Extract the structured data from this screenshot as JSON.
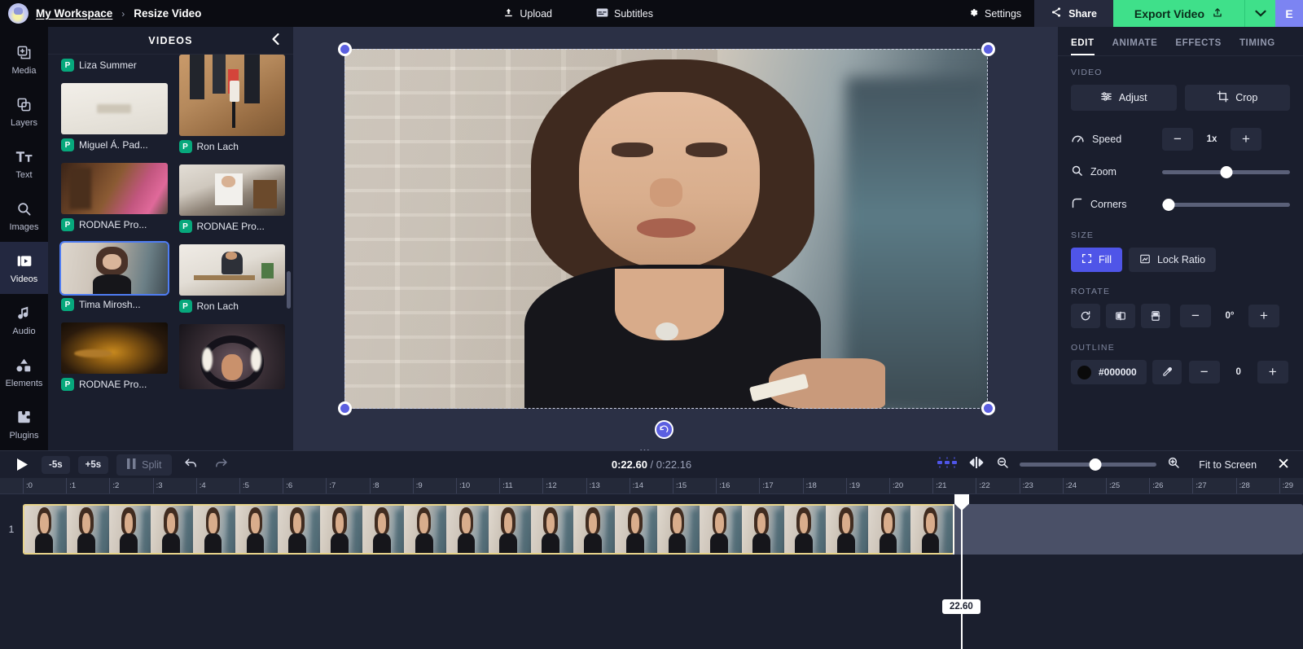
{
  "header": {
    "workspace": "My Workspace",
    "separator": "›",
    "project": "Resize Video",
    "upload": "Upload",
    "subtitles": "Subtitles",
    "settings": "Settings",
    "share": "Share",
    "export": "Export Video",
    "user_initial": "E",
    "export_color": "#3fe08a",
    "accent_color": "#4f55e8"
  },
  "rail": {
    "items": [
      {
        "label": "Media",
        "icon": "media-icon",
        "active": false
      },
      {
        "label": "Layers",
        "icon": "layers-icon",
        "active": false
      },
      {
        "label": "Text",
        "icon": "text-icon",
        "active": false
      },
      {
        "label": "Images",
        "icon": "images-search-icon",
        "active": false
      },
      {
        "label": "Videos",
        "icon": "videos-icon",
        "active": true
      },
      {
        "label": "Audio",
        "icon": "audio-note-icon",
        "active": false
      },
      {
        "label": "Elements",
        "icon": "elements-icon",
        "active": false
      },
      {
        "label": "Plugins",
        "icon": "plugins-icon",
        "active": false
      }
    ]
  },
  "videos_panel": {
    "title": "VIDEOS",
    "collapse_icon": "chevron-left-icon",
    "badge_letter": "P",
    "left_column": [
      {
        "label": "Liza Summer",
        "selected": false,
        "partial_top": true
      },
      {
        "label": "Miguel Á. Pad...",
        "selected": false
      },
      {
        "label": "RODNAE Pro...",
        "selected": false
      },
      {
        "label": "Tima Mirosh...",
        "selected": true
      },
      {
        "label": "RODNAE Pro...",
        "selected": false
      }
    ],
    "right_column": [
      {
        "label": "Ron Lach",
        "selected": false
      },
      {
        "label": "RODNAE Pro...",
        "selected": false
      },
      {
        "label": "Ron Lach",
        "selected": false
      },
      {
        "label": "",
        "selected": false
      }
    ]
  },
  "properties": {
    "tabs": [
      {
        "label": "EDIT",
        "active": true
      },
      {
        "label": "ANIMATE",
        "active": false
      },
      {
        "label": "EFFECTS",
        "active": false
      },
      {
        "label": "TIMING",
        "active": false
      }
    ],
    "video_section": "VIDEO",
    "adjust": "Adjust",
    "crop": "Crop",
    "speed_label": "Speed",
    "speed_value": "1x",
    "zoom_label": "Zoom",
    "zoom_percent": 50,
    "corners_label": "Corners",
    "corners_percent": 5,
    "size_section": "SIZE",
    "fill": "Fill",
    "lock_ratio": "Lock Ratio",
    "rotate_section": "ROTATE",
    "rotate_value": "0°",
    "outline_section": "OUTLINE",
    "outline_color": "#000000",
    "outline_width": "0",
    "minus": "−",
    "plus": "+"
  },
  "timeline": {
    "play_icon": "play-icon",
    "back_5s": "-5s",
    "forward_5s": "+5s",
    "split": "Split",
    "undo_icon": "undo-icon",
    "redo_icon": "redo-icon",
    "current_time": "0:22.60",
    "time_separator": " / ",
    "total_time": "0:22.16",
    "zoom_percent": 55,
    "fit_to_screen": "Fit to Screen",
    "close_icon": "close-icon",
    "track_number": "1",
    "playhead_label": "22.60",
    "ruler_labels": [
      ":0",
      ":1",
      ":2",
      ":3",
      ":4",
      ":5",
      ":6",
      ":7",
      ":8",
      ":9",
      ":10",
      ":11",
      ":12",
      ":13",
      ":14",
      ":15",
      ":16",
      ":17",
      ":18",
      ":19",
      ":20",
      ":21",
      ":22",
      ":23",
      ":24",
      ":25",
      ":26",
      ":27",
      ":28",
      ":29"
    ]
  }
}
